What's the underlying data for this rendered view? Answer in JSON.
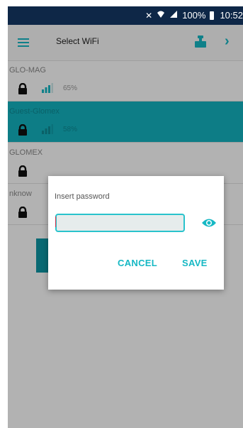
{
  "status_bar": {
    "battery": "100%",
    "time": "10:52"
  },
  "header": {
    "title": "Select WiFi"
  },
  "networks": [
    {
      "ssid": "GLO-MAG",
      "signal": "65%"
    },
    {
      "ssid": "Guest-Glomex",
      "signal": "58%"
    },
    {
      "ssid": "GLOMEX",
      "signal": ""
    },
    {
      "ssid": "nknow",
      "signal": ""
    }
  ],
  "dialog": {
    "prompt": "Insert password",
    "password_value": "",
    "cancel_label": "CANCEL",
    "save_label": "SAVE"
  },
  "colors": {
    "accent": "#16b8c4",
    "selected_row": "#13b3c0",
    "status_bar": "#0e2747"
  }
}
